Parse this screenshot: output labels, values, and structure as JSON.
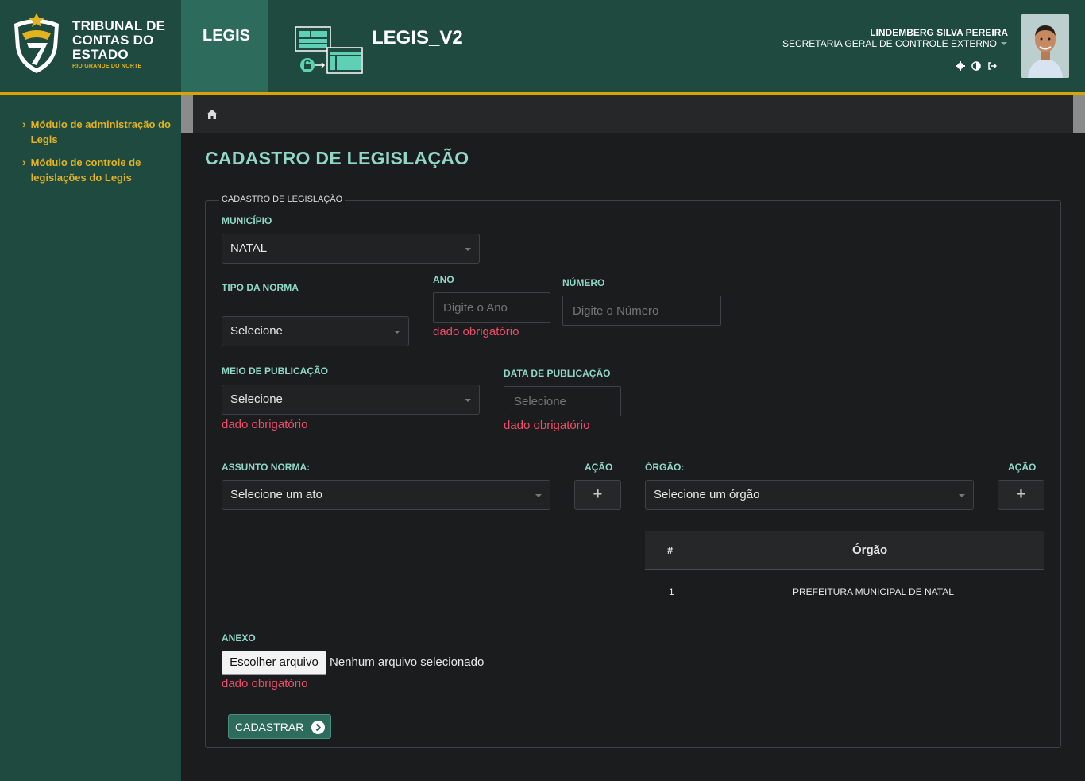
{
  "header": {
    "org_name": "TRIBUNAL DE CONTAS DO ESTADO",
    "org_sub": "RIO GRANDE DO NORTE",
    "legis_tab": "LEGIS",
    "app_title": "LEGIS_V2",
    "user_name": "LINDEMBERG SILVA PEREIRA",
    "user_dept": "SECRETARIA GERAL DE CONTROLE EXTERNO",
    "actions": [
      "gear-icon",
      "contrast-icon",
      "logout-icon"
    ]
  },
  "sidebar": {
    "items": [
      {
        "label": "Módulo de administração do Legis"
      },
      {
        "label": "Módulo de controle de legislações do Legis"
      }
    ]
  },
  "page": {
    "title": "CADASTRO DE LEGISLAÇÃO",
    "legend": "CADASTRO DE LEGISLAÇÃO"
  },
  "form": {
    "municipio": {
      "label": "MUNICÍPIO",
      "value": "NATAL"
    },
    "tipo_norma": {
      "label": "TIPO DA NORMA",
      "value": "Selecione"
    },
    "ano": {
      "label": "ANO",
      "placeholder": "Digite o Ano",
      "error": "dado obrigatório"
    },
    "numero": {
      "label": "NÚMERO",
      "placeholder": "Digite o Número"
    },
    "meio_publicacao": {
      "label": "MEIO DE PUBLICAÇÃO",
      "value": "Selecione",
      "error": "dado obrigatório"
    },
    "data_publicacao": {
      "label": "DATA DE PUBLICAÇÃO",
      "placeholder": "Selecione",
      "error": "dado obrigatório"
    },
    "assunto": {
      "label": "ASSUNTO NORMA:",
      "value": "Selecione um ato",
      "action_label": "AÇÃO",
      "action": "+"
    },
    "orgao": {
      "label": "ÓRGÃO:",
      "value": "Selecione um órgão",
      "action_label": "AÇÃO",
      "action": "+"
    },
    "anexo": {
      "label": "ANEXO",
      "button": "Escolher arquivo",
      "status": "Nenhum arquivo selecionado",
      "error": "dado obrigatório"
    },
    "submit": "CADASTRAR"
  },
  "orgao_table": {
    "headers": [
      "#",
      "Órgão"
    ],
    "rows": [
      {
        "num": "1",
        "orgao": "PREFEITURA MUNICIPAL DE NATAL"
      }
    ]
  },
  "colors": {
    "header_bg": "#1f4a40",
    "accent_gold": "#d9a400",
    "label_teal": "#8fd7c6",
    "error_red": "#ef4d6a",
    "button_green": "#2d6b5c"
  }
}
